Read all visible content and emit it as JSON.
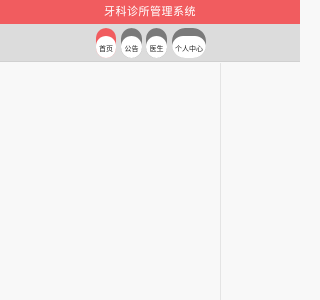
{
  "app": {
    "title": "牙科诊所管理系统"
  },
  "nav": {
    "tabs": [
      {
        "label": "首页",
        "active": true
      },
      {
        "label": "公告",
        "active": false
      },
      {
        "label": "医生",
        "active": false
      },
      {
        "label": "个人中心",
        "active": false
      }
    ]
  },
  "colors": {
    "accent": "#f15c5f",
    "tab_inactive": "#7a7a7a",
    "nav_background": "#dcdcdc",
    "page_background": "#f8f8f8"
  }
}
